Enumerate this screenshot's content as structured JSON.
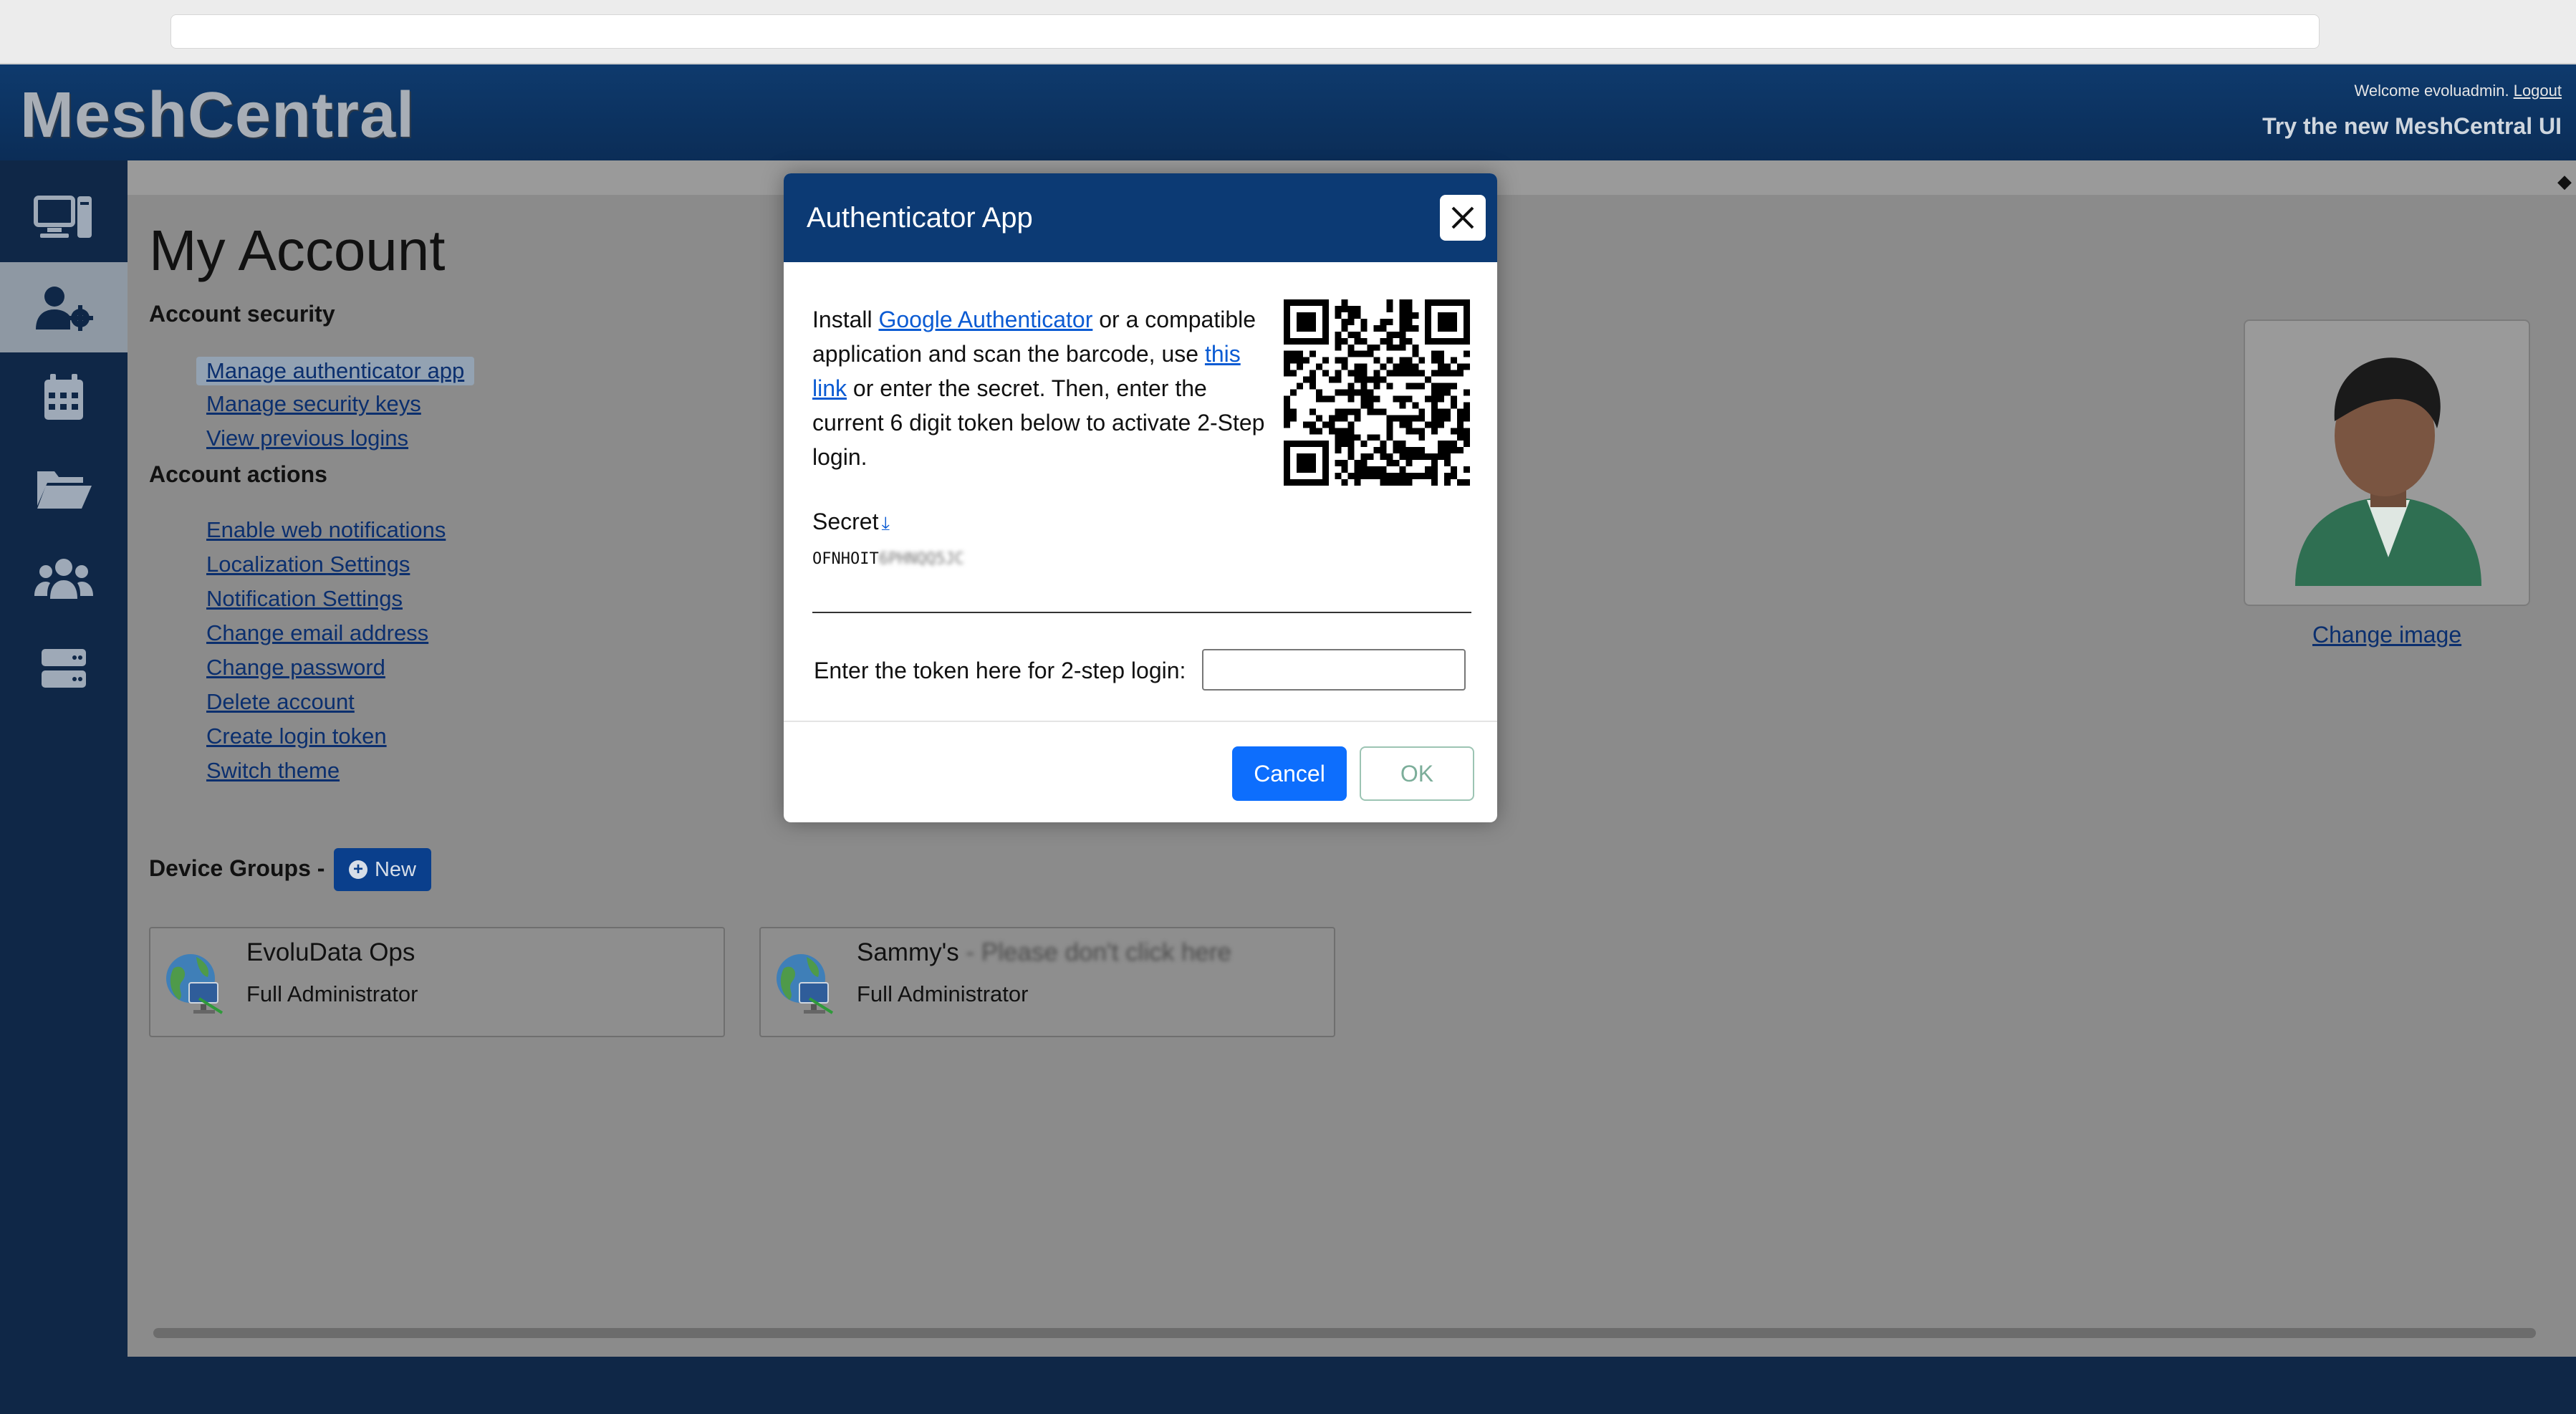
{
  "header": {
    "logo": "MeshCentral",
    "welcome_text": "Welcome evoluadmin.",
    "logout_label": "Logout",
    "new_ui_label": "Try the new MeshCentral UI"
  },
  "sidebar": {
    "items": [
      {
        "icon": "computer-icon",
        "active": false
      },
      {
        "icon": "user-gear-icon",
        "active": true
      },
      {
        "icon": "calendar-icon",
        "active": false
      },
      {
        "icon": "folder-icon",
        "active": false
      },
      {
        "icon": "users-icon",
        "active": false
      },
      {
        "icon": "server-icon",
        "active": false
      }
    ]
  },
  "page": {
    "title": "My Account",
    "account_security_heading": "Account security",
    "security_links": [
      "Manage authenticator app",
      "Manage security keys",
      "View previous logins"
    ],
    "account_actions_heading": "Account actions",
    "action_links": [
      "Enable web notifications",
      "Localization Settings",
      "Notification Settings",
      "Change email address",
      "Change password",
      "Delete account",
      "Create login token",
      "Switch theme"
    ],
    "device_groups_heading": "Device Groups -",
    "new_button_label": "New",
    "device_groups": [
      {
        "name": "EvoluData Ops",
        "suffix": "",
        "role": "Full Administrator"
      },
      {
        "name": "Sammy's",
        "suffix": " - Please don't click here",
        "role": "Full Administrator"
      }
    ],
    "change_image_label": "Change image"
  },
  "modal": {
    "title": "Authenticator App",
    "intro_prefix": "Install ",
    "intro_link1": "Google Authenticator",
    "intro_mid": " or a compatible application and scan the barcode, use ",
    "intro_link2": "this link",
    "intro_suffix": " or enter the secret. Then, enter the current 6 digit token below to activate 2-Step login.",
    "secret_label": "Secret",
    "secret_visible": "OFNHOIT",
    "secret_hidden": "6PHNQQ5JC",
    "token_label": "Enter the token here for 2-step login:",
    "token_value": "",
    "cancel_label": "Cancel",
    "ok_label": "OK"
  },
  "colors": {
    "header_bg": "#0c3a74",
    "sidebar_bg": "#0f2747",
    "primary_button": "#0d6efd",
    "link": "#0b5bd3"
  }
}
